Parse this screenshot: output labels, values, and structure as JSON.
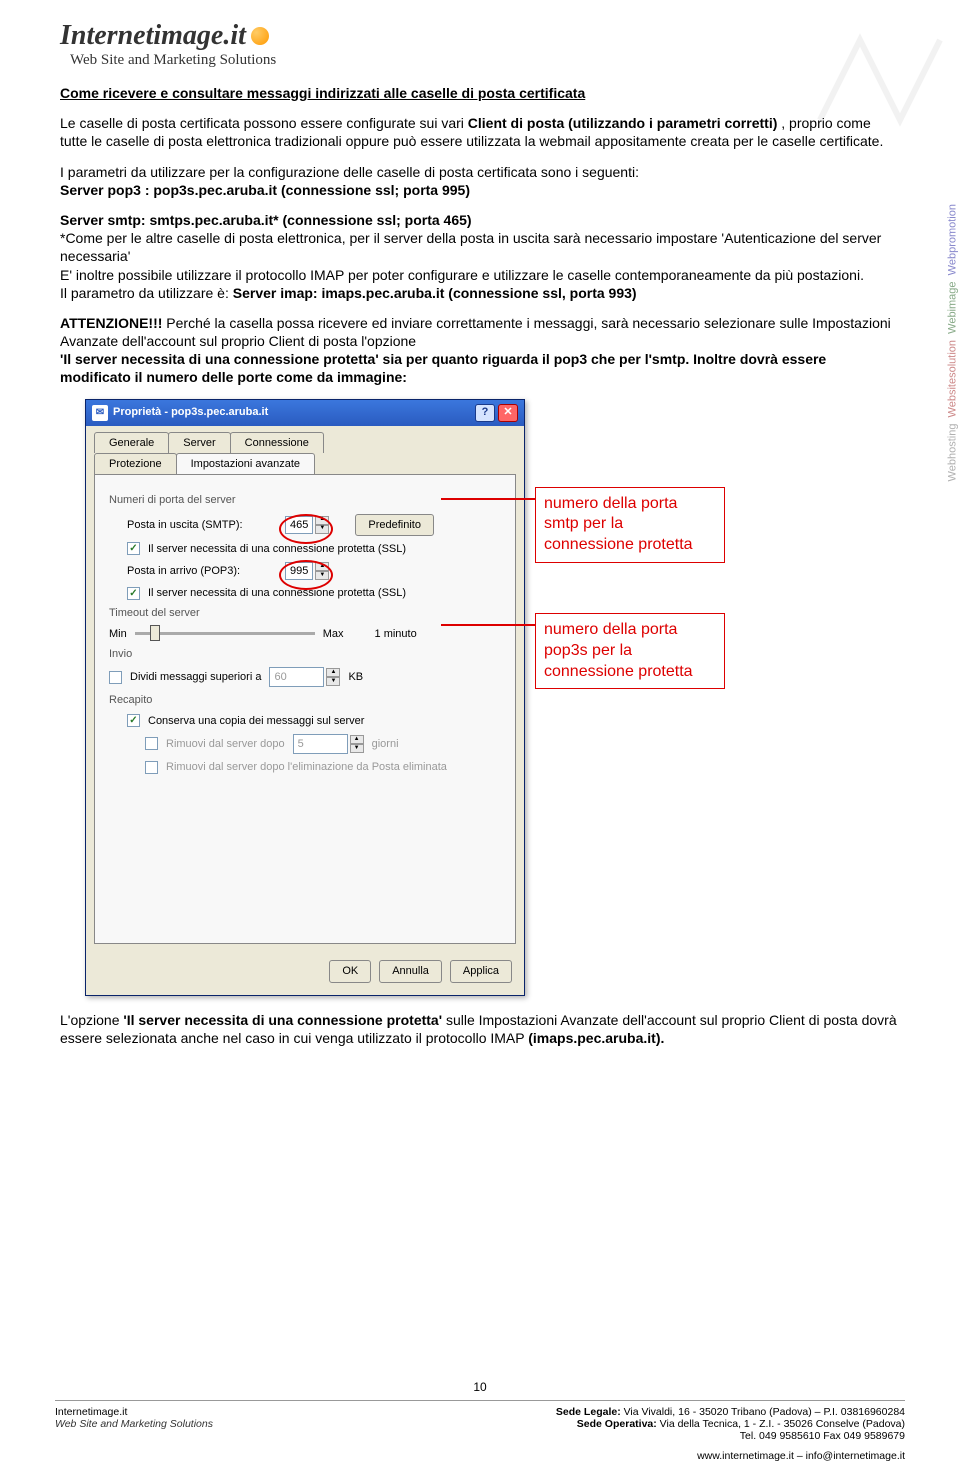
{
  "logo": {
    "name": "Internetimage.it",
    "tagline": "Web Site and Marketing Solutions"
  },
  "sidebar": {
    "w1": "Webhosting",
    "w2": "Websitesolution",
    "w3": "Webimage",
    "w4": "Webpromotion"
  },
  "article": {
    "title": "Come ricevere e consultare messaggi indirizzati alle caselle di posta certificata",
    "p1a": "Le caselle di posta certificata possono essere configurate sui vari ",
    "p1b": "Client di posta (utilizzando i parametri corretti)",
    "p1c": " , proprio come tutte le caselle di posta elettronica tradizionali oppure può essere utilizzata la webmail appositamente creata per le caselle certificate.",
    "p2a": "I parametri da utilizzare per la configurazione delle caselle di posta certificata sono i seguenti:",
    "p2b": "Server pop3 : pop3s.pec.aruba.it (connessione ssl; porta 995)",
    "p3a": "Server smtp: smtps.pec.aruba.it* (connessione ssl; porta 465)",
    "p3b": "*Come per le altre caselle di posta elettronica, per il server della posta in uscita sarà necessario impostare 'Autenticazione del server necessaria'",
    "p3c": "E' inoltre possibile utilizzare il protocollo IMAP per poter configurare e utilizzare le caselle contemporaneamente da più postazioni.",
    "p3d": "Il parametro da utilizzare è: ",
    "p3e": "Server imap: imaps.pec.aruba.it (connessione ssl, porta 993)",
    "p4a": "ATTENZIONE!!!",
    "p4b": " Perché la casella possa ricevere ed inviare correttamente i messaggi, sarà necessario selezionare sulle Impostazioni Avanzate dell'account sul proprio Client di posta l'opzione ",
    "p4c": "'Il server necessita di una connessione protetta' sia per quanto riguarda il pop3 che per l'smtp. Inoltre dovrà essere modificato il numero delle porte come da immagine:",
    "p5a": "L'opzione ",
    "p5b": "'Il server necessita di una connessione protetta'",
    "p5c": " sulle Impostazioni Avanzate dell'account sul proprio Client di posta dovrà essere selezionata anche nel caso in cui venga utilizzato il protocollo IMAP ",
    "p5d": "(imaps.pec.aruba.it)."
  },
  "callouts": {
    "smtp": "numero della porta smtp per la connessione protetta",
    "pop3": "numero della porta pop3s per la connessione protetta"
  },
  "dialog": {
    "title": "Proprietà - pop3s.pec.aruba.it",
    "tabs_top": {
      "generale": "Generale",
      "server": "Server",
      "connessione": "Connessione"
    },
    "tabs_bot": {
      "protezione": "Protezione",
      "avanzate": "Impostazioni avanzate"
    },
    "sec_ports": "Numeri di porta del server",
    "lbl_smtp": "Posta in uscita (SMTP):",
    "val_smtp": "465",
    "btn_default": "Predefinito",
    "chk_ssl_out": "Il server necessita di una connessione protetta (SSL)",
    "lbl_pop3": "Posta in arrivo (POP3):",
    "val_pop3": "995",
    "chk_ssl_in": "Il server necessita di una connessione protetta (SSL)",
    "sec_timeout": "Timeout del server",
    "min": "Min",
    "max": "Max",
    "timeout_val": "1 minuto",
    "sec_send": "Invio",
    "chk_split": "Dividi messaggi superiori a",
    "split_val": "60",
    "kb": "KB",
    "sec_delivery": "Recapito",
    "chk_keep": "Conserva una copia dei messaggi sul server",
    "chk_remove_after": "Rimuovi dal server dopo",
    "remove_val": "5",
    "days": "giorni",
    "chk_remove_deleted": "Rimuovi dal server dopo l'eliminazione da Posta eliminata",
    "btn_ok": "OK",
    "btn_cancel": "Annulla",
    "btn_apply": "Applica"
  },
  "footer": {
    "page_num": "10",
    "left1": "Internetimage.it",
    "left2": "Web Site and Marketing Solutions",
    "r1a": "Sede Legale:",
    "r1b": " Via Vivaldi, 16 - 35020 Tribano (Padova) – P.I. 03816960284",
    "r2a": "Sede Operativa:",
    "r2b": " Via della Tecnica, 1 - Z.I.  - 35026 Conselve (Padova)",
    "r3": "Tel. 049 9585610 Fax 049 9589679",
    "r4": "www.internetimage.it – info@internetimage.it"
  }
}
